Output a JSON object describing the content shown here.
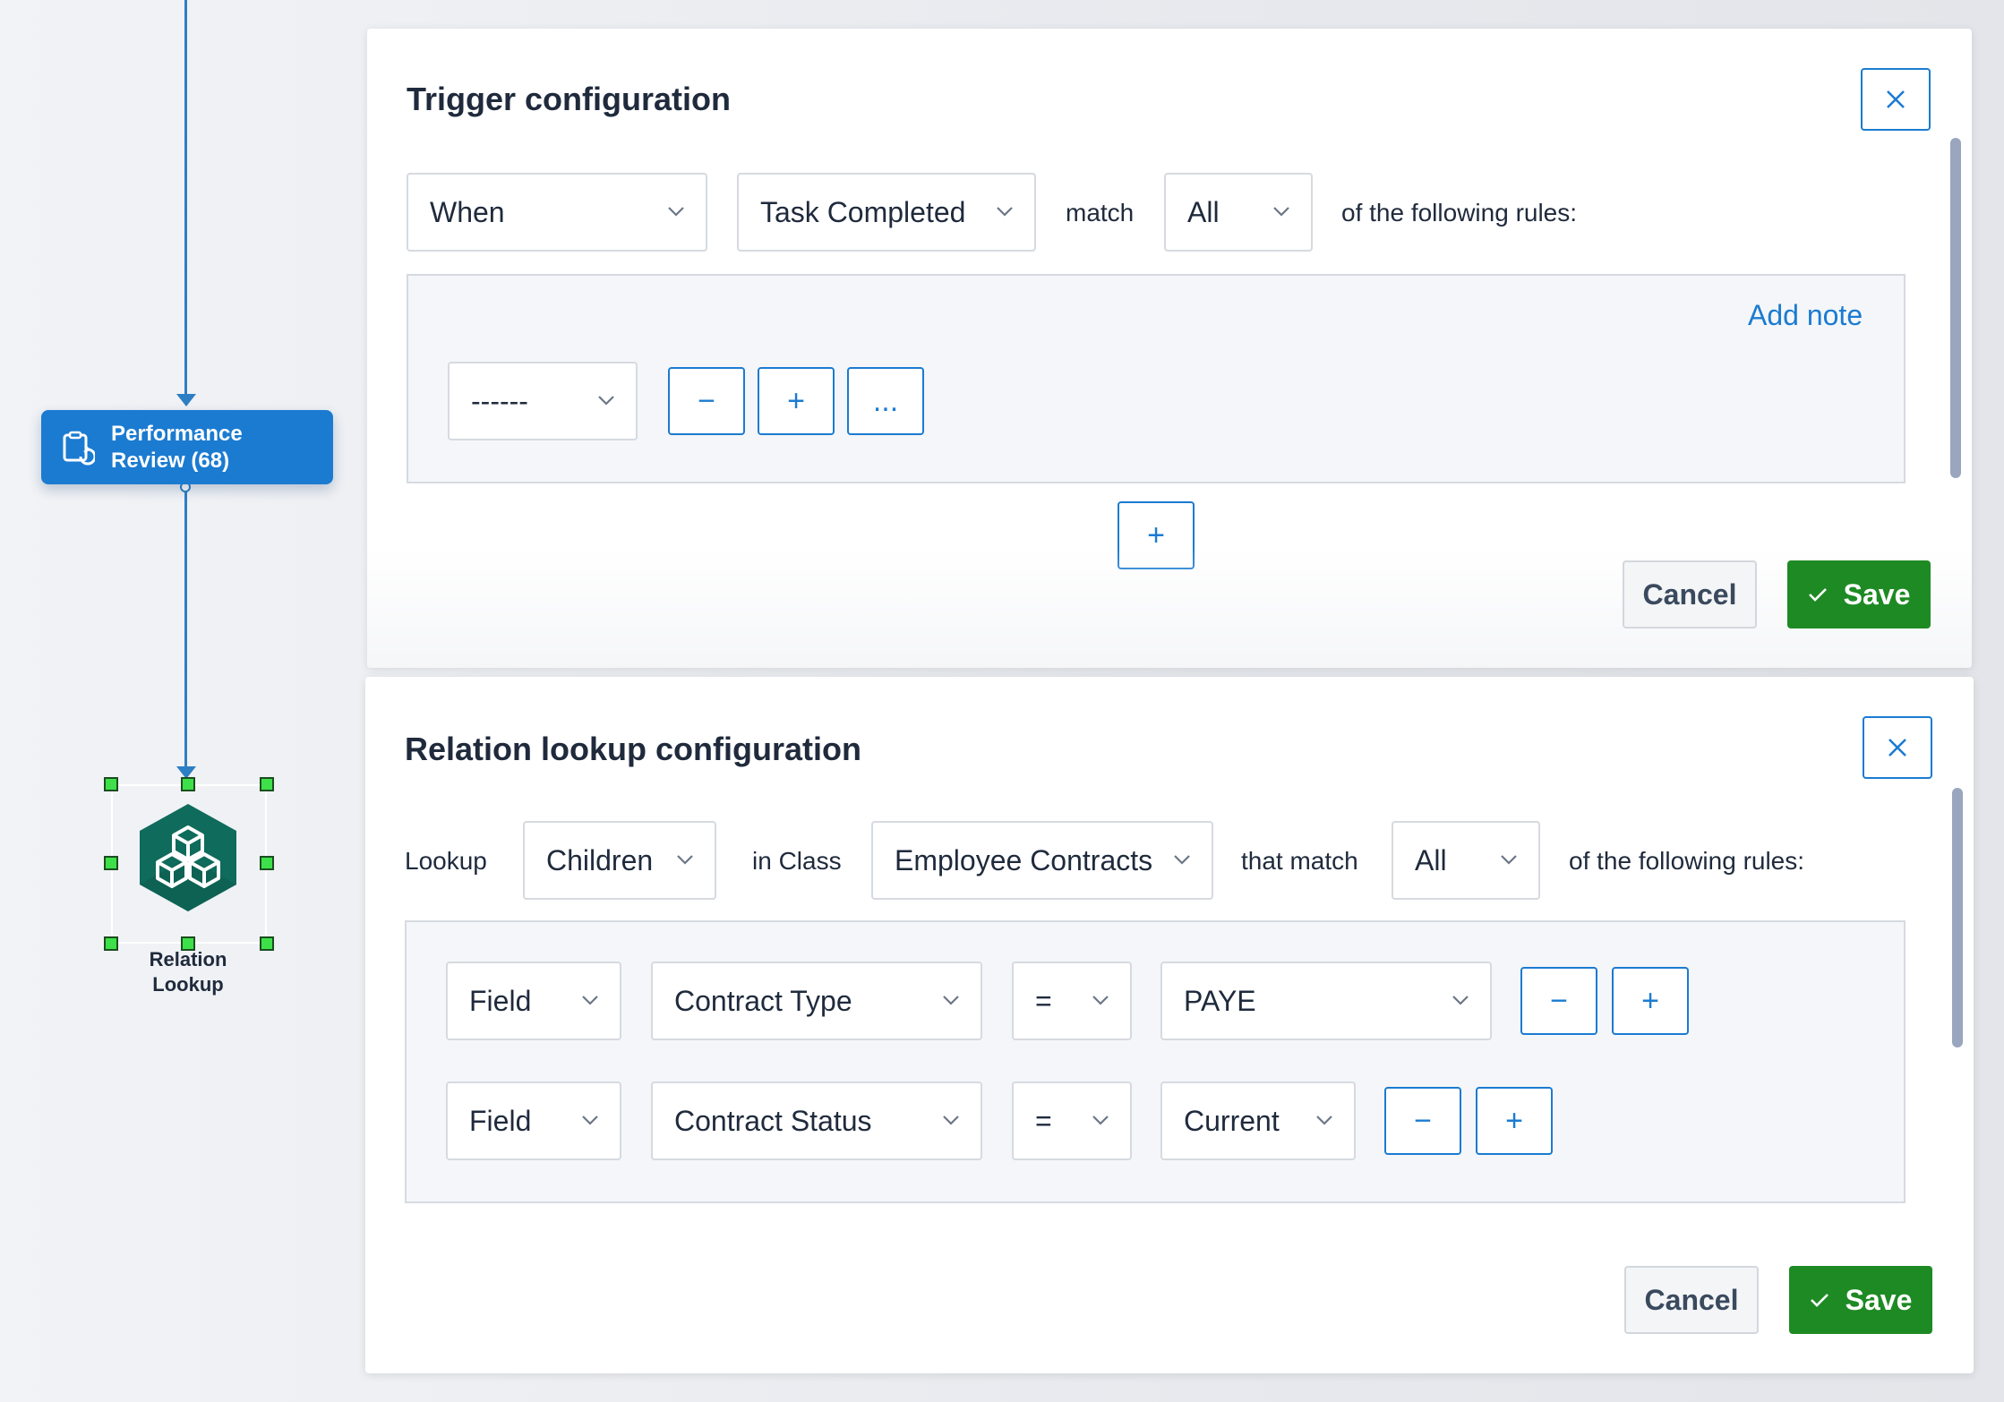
{
  "canvas": {
    "task_node": {
      "label": "Performance\nReview (68)",
      "icon": "task-refresh-icon"
    },
    "relation_node": {
      "label": "Relation\nLookup",
      "icon": "hexagon-cubes-icon"
    }
  },
  "trigger": {
    "title": "Trigger configuration",
    "when_value": "When",
    "event_value": "Task Completed",
    "match_text": "match",
    "match_value": "All",
    "rules_text": "of the following rules:",
    "add_note": "Add note",
    "rule_value": "------",
    "remove_label": "−",
    "add_label": "+",
    "more_label": "...",
    "add_group_label": "+",
    "cancel": "Cancel",
    "save": "Save"
  },
  "relation": {
    "title": "Relation lookup configuration",
    "lookup_text": "Lookup",
    "lookup_value": "Children",
    "in_class_text": "in Class",
    "class_value": "Employee Contracts",
    "that_match_text": "that match",
    "match_value": "All",
    "rules_text": "of the following rules:",
    "rules": [
      {
        "kind": "Field",
        "field": "Contract Type",
        "op": "=",
        "value": "PAYE"
      },
      {
        "kind": "Field",
        "field": "Contract Status",
        "op": "=",
        "value": "Current"
      }
    ],
    "remove_label": "−",
    "add_label": "+",
    "cancel": "Cancel",
    "save": "Save"
  },
  "colors": {
    "accent": "#1b7bd1",
    "save": "#1e8a24",
    "node": "#0f6b5c",
    "handle": "#3ee04a"
  }
}
